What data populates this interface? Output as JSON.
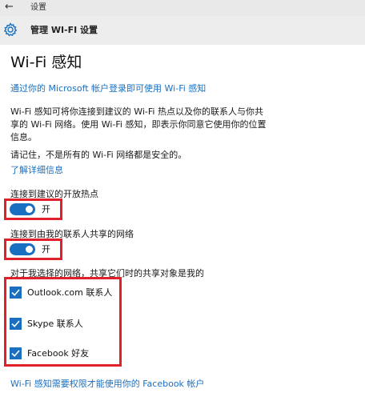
{
  "titlebar": {
    "back_icon": "←",
    "title": "设置"
  },
  "header": {
    "icon": "gear-icon",
    "title": "管理 WI-FI 设置"
  },
  "section": {
    "heading": "Wi-Fi 感知",
    "signin_link": "通过你的 Microsoft 帐户登录即可使用 Wi-Fi 感知",
    "description_line1": "Wi-Fi 感知可将你连接到建议的 Wi-Fi 热点以及你的联系人与你共",
    "description_line2": "享的 Wi-Fi 网络。使用 Wi-Fi 感知，即表示你同意它使用你的位置",
    "description_line3": "信息。",
    "note": "请记住，不是所有的 Wi-Fi 网络都是安全的。",
    "learn_more_link": "了解详细信息"
  },
  "toggles": [
    {
      "label": "连接到建议的开放热点",
      "state": "开",
      "on": true
    },
    {
      "label": "连接到由我的联系人共享的网络",
      "state": "开",
      "on": true
    }
  ],
  "sharing": {
    "label": "对于我选择的网络，共享它们时的共享对象是我的",
    "options": [
      {
        "label": "Outlook.com 联系人",
        "checked": true
      },
      {
        "label": "Skype 联系人",
        "checked": true
      },
      {
        "label": "Facebook 好友",
        "checked": true
      }
    ]
  },
  "footer_link": "Wi-Fi 感知需要权限才能使用你的 Facebook 帐户",
  "colors": {
    "accent": "#1a6fc0",
    "highlight_box": "#e0212a"
  }
}
